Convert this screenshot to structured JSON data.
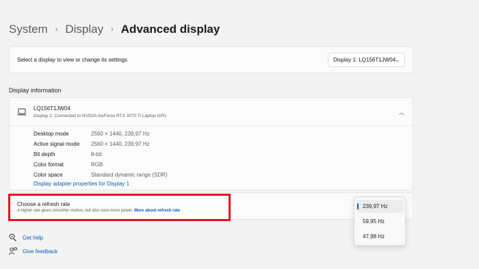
{
  "breadcrumb": {
    "root": "System",
    "parent": "Display",
    "current": "Advanced display"
  },
  "display_select": {
    "label": "Select a display to view or change its settings",
    "value": "Display 1: LQ156T1JW04"
  },
  "display_info": {
    "section_title": "Display information",
    "monitor_name": "LQ156T1JW04",
    "monitor_subtitle": "Display 1: Connected to NVIDIA GeForce RTX 3070 Ti Laptop GPU",
    "rows": [
      {
        "key": "Desktop mode",
        "value": "2560 × 1440, 239,97 Hz"
      },
      {
        "key": "Active signal mode",
        "value": "2560 × 1440, 239,97 Hz"
      },
      {
        "key": "Bit depth",
        "value": "8-bit"
      },
      {
        "key": "Color format",
        "value": "RGB"
      },
      {
        "key": "Color space",
        "value": "Standard dynamic range (SDR)"
      }
    ],
    "adapter_link": "Display adapter properties for Display 1"
  },
  "refresh_rate": {
    "title": "Choose a refresh rate",
    "description": "A higher rate gives smoother motion, but also uses more power.",
    "more_link": "More about refresh rate",
    "options": [
      "239,97 Hz",
      "59,95 Hz",
      "47,98 Hz"
    ],
    "selected": "239,97 Hz"
  },
  "footer": {
    "help": "Get help",
    "feedback": "Give feedback"
  },
  "colors": {
    "accent": "#0067c0",
    "link": "#0a5bb5",
    "highlight_border": "#e3101e",
    "background": "#f3f3f3"
  }
}
